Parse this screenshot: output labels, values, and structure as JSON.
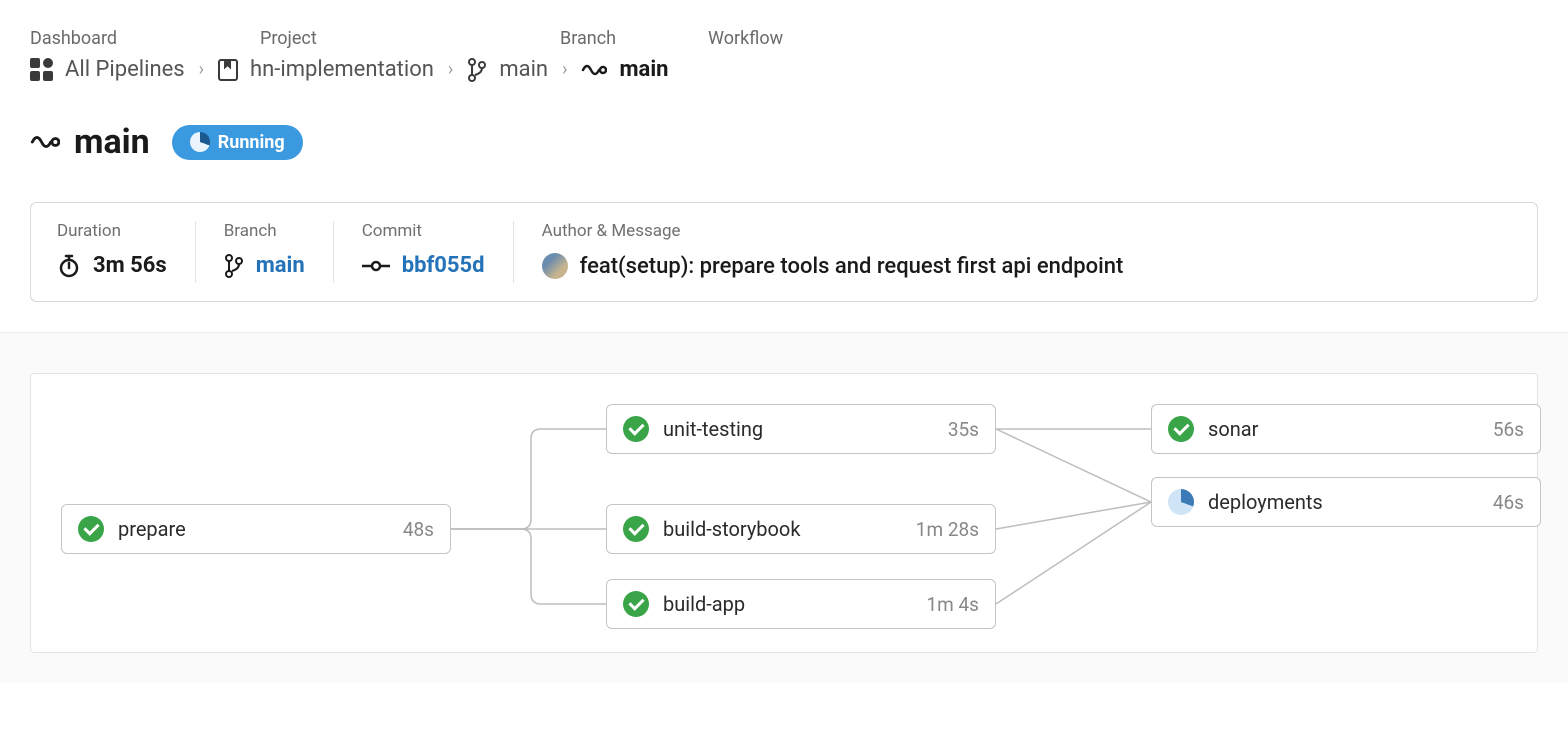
{
  "breadcrumb": {
    "labels": [
      "Dashboard",
      "Project",
      "Branch",
      "Workflow"
    ],
    "items": [
      {
        "text": "All Pipelines"
      },
      {
        "text": "hn-implementation"
      },
      {
        "text": "main"
      },
      {
        "text": "main"
      }
    ]
  },
  "title": {
    "name": "main",
    "status_label": "Running"
  },
  "meta": {
    "duration_label": "Duration",
    "duration_value": "3m 56s",
    "branch_label": "Branch",
    "branch_value": "main",
    "commit_label": "Commit",
    "commit_value": "bbf055d",
    "author_label": "Author & Message",
    "message": "feat(setup): prepare tools and request first api endpoint"
  },
  "jobs": {
    "prepare": {
      "name": "prepare",
      "time": "48s",
      "status": "success"
    },
    "unit_testing": {
      "name": "unit-testing",
      "time": "35s",
      "status": "success"
    },
    "build_storybook": {
      "name": "build-storybook",
      "time": "1m 28s",
      "status": "success"
    },
    "build_app": {
      "name": "build-app",
      "time": "1m 4s",
      "status": "success"
    },
    "sonar": {
      "name": "sonar",
      "time": "56s",
      "status": "success"
    },
    "deployments": {
      "name": "deployments",
      "time": "46s",
      "status": "running"
    }
  }
}
